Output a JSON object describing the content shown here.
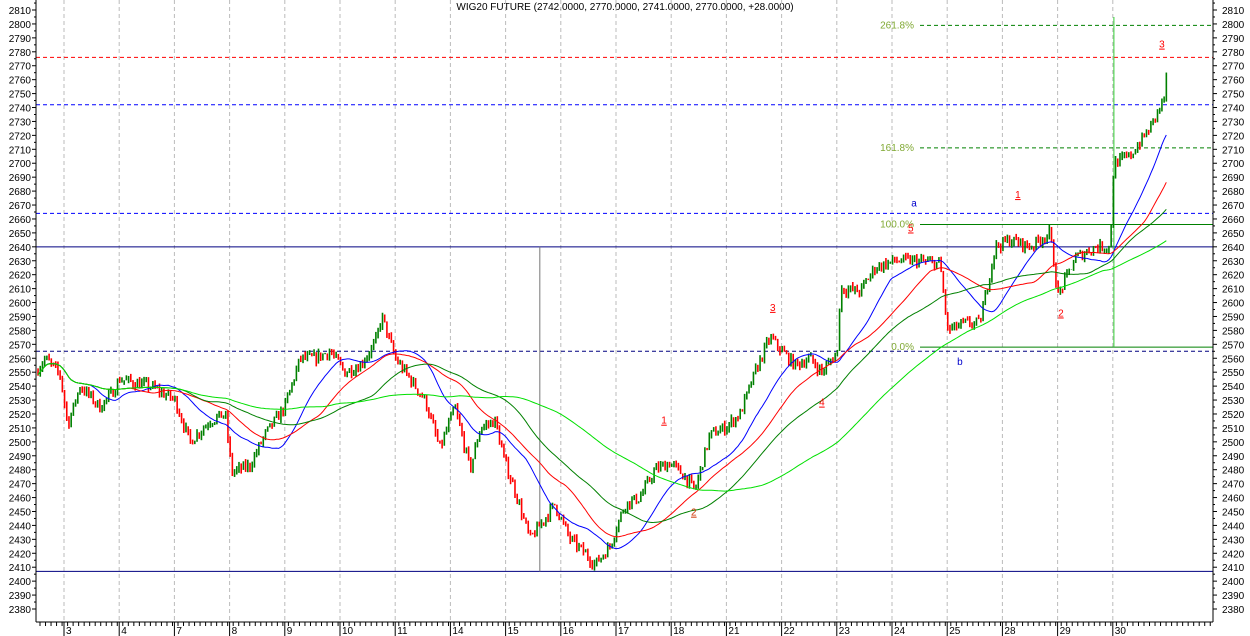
{
  "chart_data": {
    "type": "line",
    "title": "WIG20 FUTURE (2742.0000, 2770.0000, 2741.0000, 2770.0000, +28.0000)",
    "ylim": [
      2380,
      2810
    ],
    "y_ticks": [
      2380,
      2390,
      2400,
      2410,
      2420,
      2430,
      2440,
      2450,
      2460,
      2470,
      2480,
      2490,
      2500,
      2510,
      2520,
      2530,
      2540,
      2550,
      2560,
      2570,
      2580,
      2590,
      2600,
      2610,
      2620,
      2630,
      2640,
      2650,
      2660,
      2670,
      2680,
      2690,
      2700,
      2710,
      2720,
      2730,
      2740,
      2750,
      2760,
      2770,
      2780,
      2790,
      2800,
      2810
    ],
    "x_tick_labels": [
      "3",
      "4",
      "7",
      "8",
      "9",
      "10",
      "11",
      "14",
      "15",
      "16",
      "17",
      "18",
      "21",
      "22",
      "23",
      "24",
      "25",
      "28",
      "29",
      "30"
    ],
    "grid": "vertical dashed at day boundaries",
    "price_path": [
      [
        -0.51,
        2550
      ],
      [
        -0.34,
        2560
      ],
      [
        -0.07,
        2548
      ],
      [
        0.07,
        2512
      ],
      [
        0.29,
        2540
      ],
      [
        0.65,
        2525
      ],
      [
        0.87,
        2535
      ],
      [
        1.01,
        2545
      ],
      [
        1.56,
        2540
      ],
      [
        2.01,
        2530
      ],
      [
        2.28,
        2500
      ],
      [
        2.64,
        2515
      ],
      [
        2.92,
        2520
      ],
      [
        3.04,
        2478
      ],
      [
        3.37,
        2483
      ],
      [
        3.64,
        2505
      ],
      [
        4.0,
        2525
      ],
      [
        4.28,
        2560
      ],
      [
        4.55,
        2560
      ],
      [
        4.82,
        2565
      ],
      [
        5.09,
        2550
      ],
      [
        5.36,
        2555
      ],
      [
        5.63,
        2570
      ],
      [
        5.76,
        2590
      ],
      [
        6.0,
        2560
      ],
      [
        6.27,
        2545
      ],
      [
        6.54,
        2530
      ],
      [
        6.81,
        2495
      ],
      [
        7.08,
        2525
      ],
      [
        7.36,
        2480
      ],
      [
        7.54,
        2510
      ],
      [
        7.81,
        2515
      ],
      [
        7.99,
        2485
      ],
      [
        8.17,
        2465
      ],
      [
        8.44,
        2430
      ],
      [
        8.71,
        2445
      ],
      [
        8.89,
        2455
      ],
      [
        9.17,
        2430
      ],
      [
        9.44,
        2420
      ],
      [
        9.62,
        2412
      ],
      [
        9.89,
        2425
      ],
      [
        10.02,
        2440
      ],
      [
        10.16,
        2455
      ],
      [
        10.43,
        2460
      ],
      [
        10.71,
        2480
      ],
      [
        10.98,
        2485
      ],
      [
        11.25,
        2475
      ],
      [
        11.43,
        2465
      ],
      [
        11.7,
        2505
      ],
      [
        11.97,
        2510
      ],
      [
        12.25,
        2520
      ],
      [
        12.52,
        2550
      ],
      [
        12.79,
        2575
      ],
      [
        13.01,
        2565
      ],
      [
        13.24,
        2555
      ],
      [
        13.51,
        2560
      ],
      [
        13.73,
        2550
      ],
      [
        14.02,
        2565
      ],
      [
        14.06,
        2610
      ],
      [
        14.42,
        2608
      ],
      [
        14.69,
        2625
      ],
      [
        15.05,
        2630
      ],
      [
        15.42,
        2630
      ],
      [
        15.87,
        2628
      ],
      [
        16.01,
        2580
      ],
      [
        16.32,
        2585
      ],
      [
        16.59,
        2585
      ],
      [
        16.87,
        2640
      ],
      [
        17.14,
        2645
      ],
      [
        17.5,
        2640
      ],
      [
        17.86,
        2650
      ],
      [
        18.01,
        2605
      ],
      [
        18.32,
        2632
      ],
      [
        18.68,
        2640
      ],
      [
        18.95,
        2640
      ],
      [
        19.02,
        2700
      ],
      [
        19.31,
        2705
      ],
      [
        19.67,
        2725
      ],
      [
        19.95,
        2748
      ],
      [
        19.98,
        2770
      ]
    ],
    "moving_averages": [
      {
        "name": "MA short",
        "color": "#0000ff",
        "period": 8
      },
      {
        "name": "MA medium",
        "color": "#ff0000",
        "period": 14
      },
      {
        "name": "MA long",
        "color": "#008000",
        "period": 22
      },
      {
        "name": "MA very long",
        "color": "#00e000",
        "period": 40
      }
    ],
    "colors": {
      "up": "#008000",
      "down": "#ff0000"
    },
    "horizontal_lines": [
      {
        "price": 2776,
        "color": "#ff0000",
        "style": "dashed"
      },
      {
        "price": 2742,
        "color": "#0000ff",
        "style": "dashed"
      },
      {
        "price": 2664,
        "color": "#0000ff",
        "style": "dashed"
      },
      {
        "price": 2640,
        "color": "#000080",
        "style": "solid"
      },
      {
        "price": 2565,
        "color": "#000080",
        "style": "dashed"
      },
      {
        "price": 2407,
        "color": "#000080",
        "style": "solid"
      }
    ],
    "fibonacci": [
      {
        "label": "261.8%",
        "price": 2799
      },
      {
        "label": "161.8%",
        "price": 2711
      },
      {
        "label": "100.0%",
        "price": 2656
      },
      {
        "label": "0.0%",
        "price": 2568
      }
    ],
    "vertical_lines": [
      {
        "day": 8.62,
        "from": 2407,
        "to": 2640,
        "color": "#777777"
      },
      {
        "day": 19.02,
        "from": 2568,
        "to": 2805,
        "color": "#33cc33"
      }
    ],
    "wave_labels": [
      {
        "text": "1",
        "day": 10.87,
        "price": 2513,
        "color": "#ff0000"
      },
      {
        "text": "2",
        "day": 11.41,
        "price": 2447,
        "color": "#cc3300"
      },
      {
        "text": "3",
        "day": 12.84,
        "price": 2594,
        "color": "#ff0000"
      },
      {
        "text": "4",
        "day": 13.73,
        "price": 2526,
        "color": "#ff0000"
      },
      {
        "text": "5",
        "day": 15.34,
        "price": 2651,
        "color": "#ff0000"
      },
      {
        "text": "a",
        "day": 15.4,
        "price": 2669,
        "color": "#0000cc"
      },
      {
        "text": "b",
        "day": 16.23,
        "price": 2555,
        "color": "#0000cc"
      },
      {
        "text": "1",
        "day": 17.28,
        "price": 2675,
        "color": "#ff0000"
      },
      {
        "text": "2",
        "day": 18.06,
        "price": 2590,
        "color": "#ff0000"
      },
      {
        "text": "3",
        "day": 19.89,
        "price": 2783,
        "color": "#ff0000"
      }
    ]
  }
}
